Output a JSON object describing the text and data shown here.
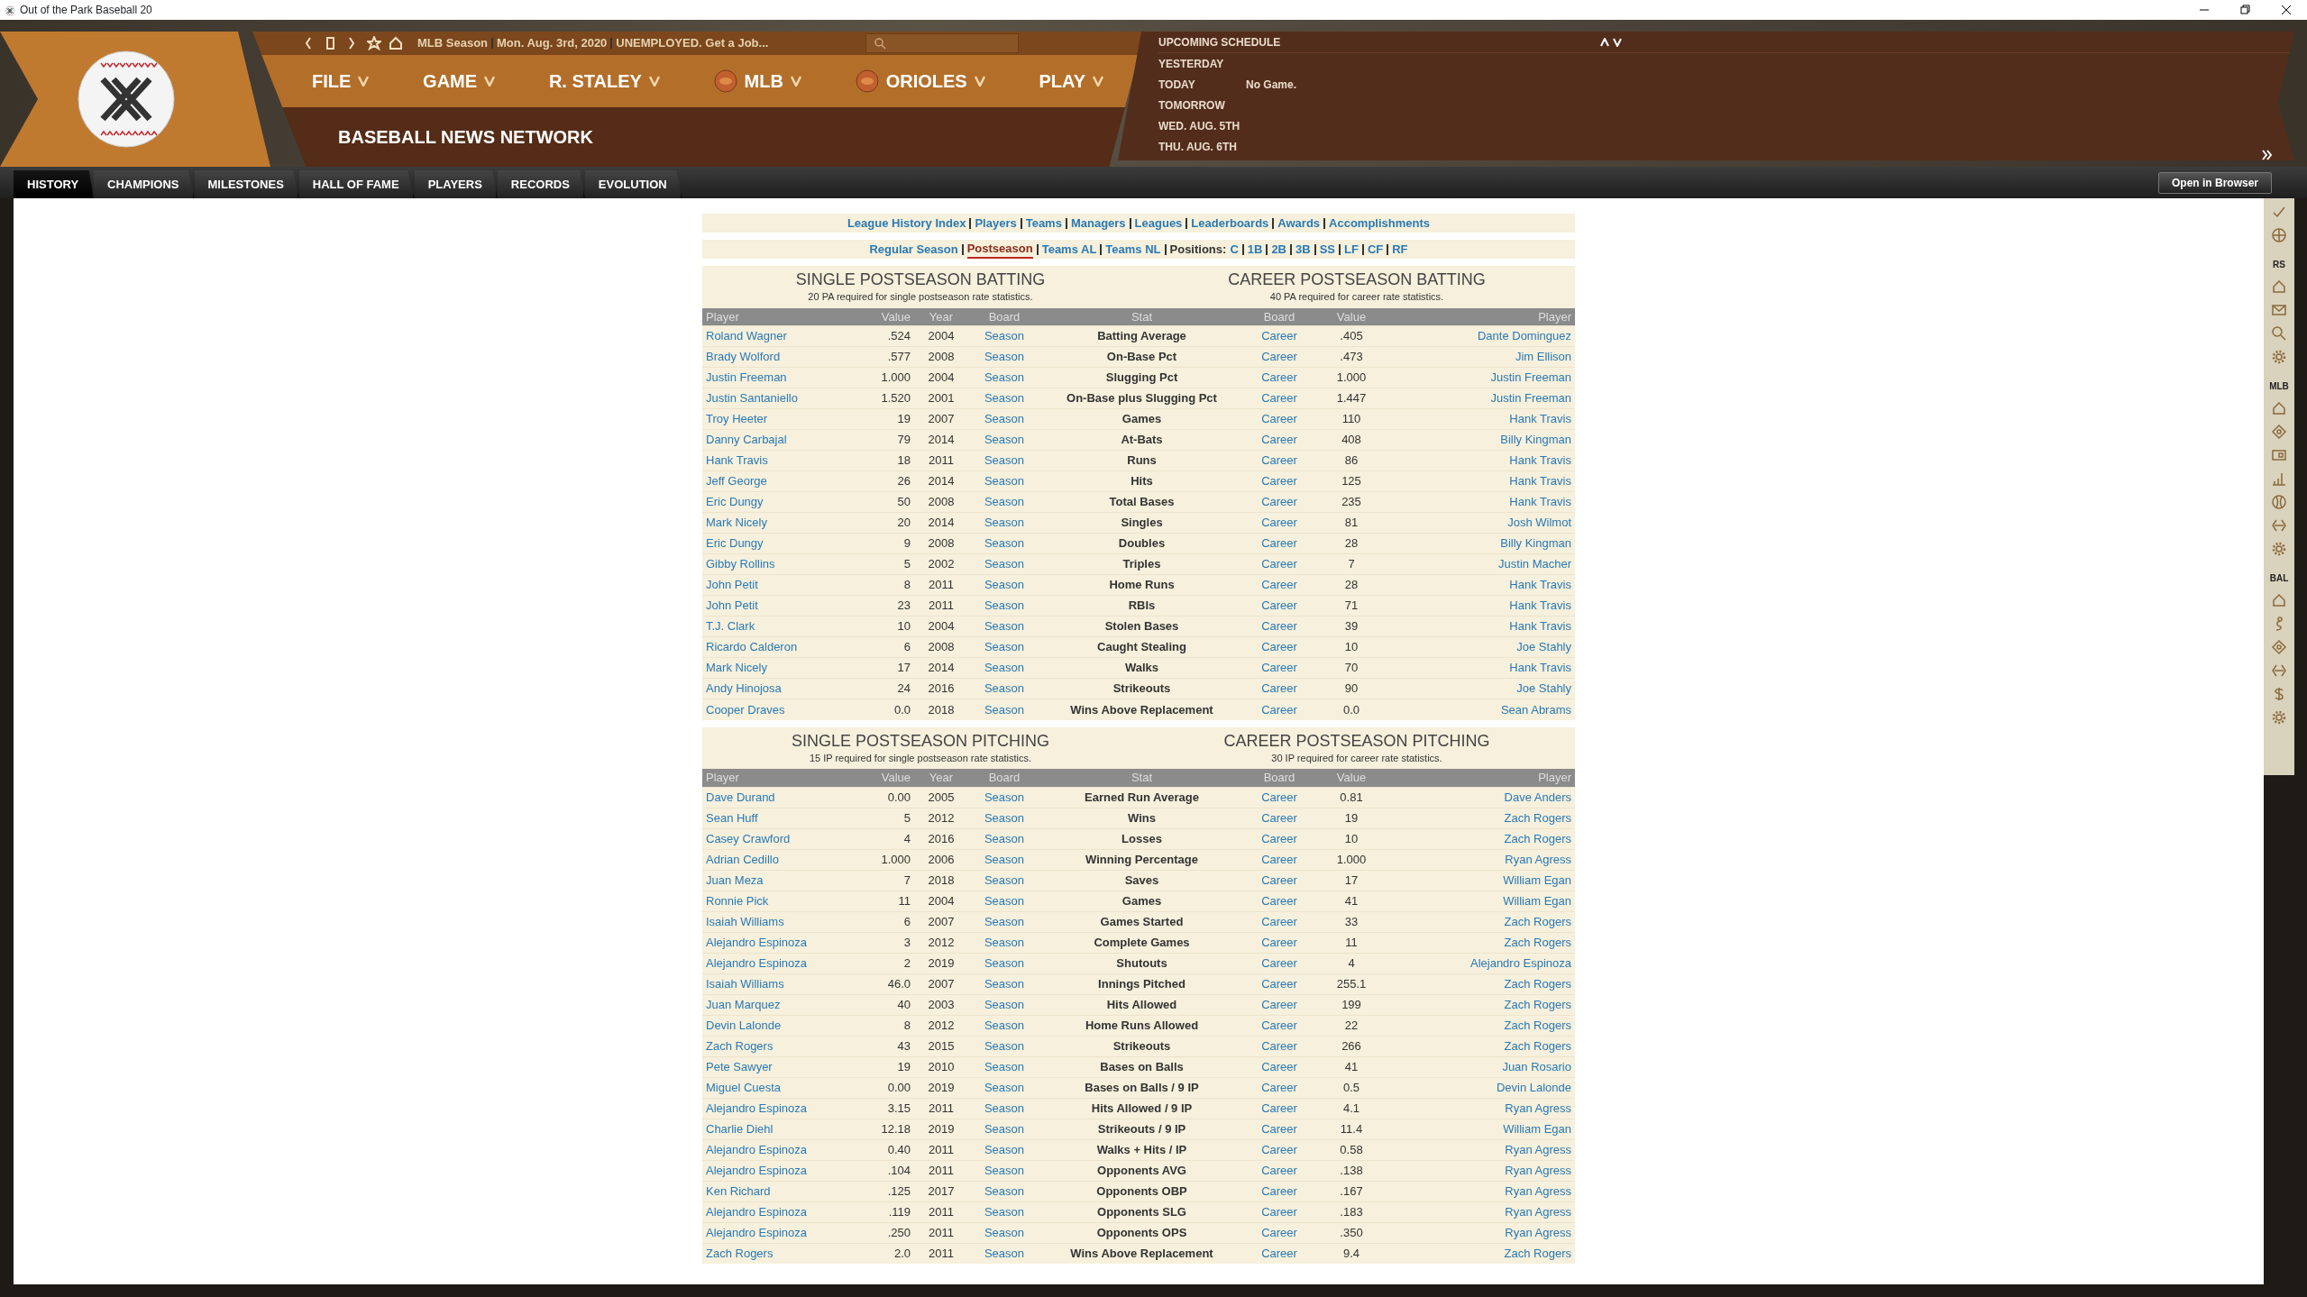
{
  "window": {
    "title": "Out of the Park Baseball 20"
  },
  "breadcrumb": [
    "MLB Season",
    "Mon. Aug. 3rd, 2020",
    "UNEMPLOYED. Get a Job..."
  ],
  "menu": [
    {
      "label": "FILE",
      "kind": "plain"
    },
    {
      "label": "GAME",
      "kind": "plain"
    },
    {
      "label": "R. STALEY",
      "kind": "plain"
    },
    {
      "label": "MLB",
      "kind": "logo"
    },
    {
      "label": "ORIOLES",
      "kind": "logo"
    },
    {
      "label": "PLAY",
      "kind": "plain"
    }
  ],
  "page_title": "BASEBALL NEWS NETWORK",
  "schedule": {
    "title": "UPCOMING SCHEDULE",
    "days": [
      {
        "label": "YESTERDAY"
      },
      {
        "label": "TODAY",
        "game": "No Game."
      },
      {
        "label": "TOMORROW"
      },
      {
        "label": "WED. AUG. 5TH"
      },
      {
        "label": "THU. AUG. 6TH"
      }
    ]
  },
  "tabs": [
    {
      "label": "HISTORY",
      "selected": true
    },
    {
      "label": "CHAMPIONS",
      "selected": false
    },
    {
      "label": "MILESTONES",
      "selected": false
    },
    {
      "label": "HALL OF FAME",
      "selected": false
    },
    {
      "label": "PLAYERS",
      "selected": false
    },
    {
      "label": "RECORDS",
      "selected": false
    },
    {
      "label": "EVOLUTION",
      "selected": false
    }
  ],
  "open_in_browser": "Open in Browser",
  "sidebar_sections": [
    "RS",
    "MLB",
    "BAL"
  ],
  "links": [
    "League History Index",
    "Players",
    "Teams",
    "Managers",
    "Leagues",
    "Leaderboards",
    "Awards",
    "Accomplishments"
  ],
  "views": [
    {
      "label": "Regular Season",
      "selected": false
    },
    {
      "label": "Postseason",
      "selected": true
    },
    {
      "label": "Teams AL",
      "selected": false
    },
    {
      "label": "Teams NL",
      "selected": false
    }
  ],
  "positions_label": "Positions:",
  "positions": [
    "C",
    "1B",
    "2B",
    "3B",
    "SS",
    "LF",
    "CF",
    "RF"
  ],
  "batting": {
    "single_title": "SINGLE POSTSEASON BATTING",
    "single_note": "20 PA required for single postseason rate statistics.",
    "career_title": "CAREER POSTSEASON BATTING",
    "career_note": "40 PA required for career rate statistics.",
    "columns": [
      "Player",
      "Value",
      "Year",
      "Board",
      "Stat",
      "Board",
      "Value",
      "Player"
    ],
    "rows": [
      [
        "Roland Wagner",
        ".524",
        "2004",
        "Season",
        "Batting Average",
        "Career",
        ".405",
        "Dante Dominguez"
      ],
      [
        "Brady Wolford",
        ".577",
        "2008",
        "Season",
        "On-Base Pct",
        "Career",
        ".473",
        "Jim Ellison"
      ],
      [
        "Justin Freeman",
        "1.000",
        "2004",
        "Season",
        "Slugging Pct",
        "Career",
        "1.000",
        "Justin Freeman"
      ],
      [
        "Justin Santaniello",
        "1.520",
        "2001",
        "Season",
        "On-Base plus Slugging Pct",
        "Career",
        "1.447",
        "Justin Freeman"
      ],
      [
        "Troy Heeter",
        "19",
        "2007",
        "Season",
        "Games",
        "Career",
        "110",
        "Hank Travis"
      ],
      [
        "Danny Carbajal",
        "79",
        "2014",
        "Season",
        "At-Bats",
        "Career",
        "408",
        "Billy Kingman"
      ],
      [
        "Hank Travis",
        "18",
        "2011",
        "Season",
        "Runs",
        "Career",
        "86",
        "Hank Travis"
      ],
      [
        "Jeff George",
        "26",
        "2014",
        "Season",
        "Hits",
        "Career",
        "125",
        "Hank Travis"
      ],
      [
        "Eric Dungy",
        "50",
        "2008",
        "Season",
        "Total Bases",
        "Career",
        "235",
        "Hank Travis"
      ],
      [
        "Mark Nicely",
        "20",
        "2014",
        "Season",
        "Singles",
        "Career",
        "81",
        "Josh Wilmot"
      ],
      [
        "Eric Dungy",
        "9",
        "2008",
        "Season",
        "Doubles",
        "Career",
        "28",
        "Billy Kingman"
      ],
      [
        "Gibby Rollins",
        "5",
        "2002",
        "Season",
        "Triples",
        "Career",
        "7",
        "Justin Macher"
      ],
      [
        "John Petit",
        "8",
        "2011",
        "Season",
        "Home Runs",
        "Career",
        "28",
        "Hank Travis"
      ],
      [
        "John Petit",
        "23",
        "2011",
        "Season",
        "RBIs",
        "Career",
        "71",
        "Hank Travis"
      ],
      [
        "T.J. Clark",
        "10",
        "2004",
        "Season",
        "Stolen Bases",
        "Career",
        "39",
        "Hank Travis"
      ],
      [
        "Ricardo Calderon",
        "6",
        "2008",
        "Season",
        "Caught Stealing",
        "Career",
        "10",
        "Joe Stahly"
      ],
      [
        "Mark Nicely",
        "17",
        "2014",
        "Season",
        "Walks",
        "Career",
        "70",
        "Hank Travis"
      ],
      [
        "Andy Hinojosa",
        "24",
        "2016",
        "Season",
        "Strikeouts",
        "Career",
        "90",
        "Joe Stahly"
      ],
      [
        "Cooper Draves",
        "0.0",
        "2018",
        "Season",
        "Wins Above Replacement",
        "Career",
        "0.0",
        "Sean Abrams"
      ]
    ]
  },
  "pitching": {
    "single_title": "SINGLE POSTSEASON PITCHING",
    "single_note": "15 IP required for single postseason rate statistics.",
    "career_title": "CAREER POSTSEASON PITCHING",
    "career_note": "30 IP required for career rate statistics.",
    "columns": [
      "Player",
      "Value",
      "Year",
      "Board",
      "Stat",
      "Board",
      "Value",
      "Player"
    ],
    "rows": [
      [
        "Dave Durand",
        "0.00",
        "2005",
        "Season",
        "Earned Run Average",
        "Career",
        "0.81",
        "Dave Anders"
      ],
      [
        "Sean Huff",
        "5",
        "2012",
        "Season",
        "Wins",
        "Career",
        "19",
        "Zach Rogers"
      ],
      [
        "Casey Crawford",
        "4",
        "2016",
        "Season",
        "Losses",
        "Career",
        "10",
        "Zach Rogers"
      ],
      [
        "Adrian Cedillo",
        "1.000",
        "2006",
        "Season",
        "Winning Percentage",
        "Career",
        "1.000",
        "Ryan Agress"
      ],
      [
        "Juan Meza",
        "7",
        "2018",
        "Season",
        "Saves",
        "Career",
        "17",
        "William Egan"
      ],
      [
        "Ronnie Pick",
        "11",
        "2004",
        "Season",
        "Games",
        "Career",
        "41",
        "William Egan"
      ],
      [
        "Isaiah Williams",
        "6",
        "2007",
        "Season",
        "Games Started",
        "Career",
        "33",
        "Zach Rogers"
      ],
      [
        "Alejandro Espinoza",
        "3",
        "2012",
        "Season",
        "Complete Games",
        "Career",
        "11",
        "Zach Rogers"
      ],
      [
        "Alejandro Espinoza",
        "2",
        "2019",
        "Season",
        "Shutouts",
        "Career",
        "4",
        "Alejandro Espinoza"
      ],
      [
        "Isaiah Williams",
        "46.0",
        "2007",
        "Season",
        "Innings Pitched",
        "Career",
        "255.1",
        "Zach Rogers"
      ],
      [
        "Juan Marquez",
        "40",
        "2003",
        "Season",
        "Hits Allowed",
        "Career",
        "199",
        "Zach Rogers"
      ],
      [
        "Devin Lalonde",
        "8",
        "2012",
        "Season",
        "Home Runs Allowed",
        "Career",
        "22",
        "Zach Rogers"
      ],
      [
        "Zach Rogers",
        "43",
        "2015",
        "Season",
        "Strikeouts",
        "Career",
        "266",
        "Zach Rogers"
      ],
      [
        "Pete Sawyer",
        "19",
        "2010",
        "Season",
        "Bases on Balls",
        "Career",
        "41",
        "Juan Rosario"
      ],
      [
        "Miguel Cuesta",
        "0.00",
        "2019",
        "Season",
        "Bases on Balls / 9 IP",
        "Career",
        "0.5",
        "Devin Lalonde"
      ],
      [
        "Alejandro Espinoza",
        "3.15",
        "2011",
        "Season",
        "Hits Allowed / 9 IP",
        "Career",
        "4.1",
        "Ryan Agress"
      ],
      [
        "Charlie Diehl",
        "12.18",
        "2019",
        "Season",
        "Strikeouts / 9 IP",
        "Career",
        "11.4",
        "William Egan"
      ],
      [
        "Alejandro Espinoza",
        "0.40",
        "2011",
        "Season",
        "Walks + Hits / IP",
        "Career",
        "0.58",
        "Ryan Agress"
      ],
      [
        "Alejandro Espinoza",
        ".104",
        "2011",
        "Season",
        "Opponents AVG",
        "Career",
        ".138",
        "Ryan Agress"
      ],
      [
        "Ken Richard",
        ".125",
        "2017",
        "Season",
        "Opponents OBP",
        "Career",
        ".167",
        "Ryan Agress"
      ],
      [
        "Alejandro Espinoza",
        ".119",
        "2011",
        "Season",
        "Opponents SLG",
        "Career",
        ".183",
        "Ryan Agress"
      ],
      [
        "Alejandro Espinoza",
        ".250",
        "2011",
        "Season",
        "Opponents OPS",
        "Career",
        ".350",
        "Ryan Agress"
      ],
      [
        "Zach Rogers",
        "2.0",
        "2011",
        "Season",
        "Wins Above Replacement",
        "Career",
        "9.4",
        "Zach Rogers"
      ]
    ]
  }
}
